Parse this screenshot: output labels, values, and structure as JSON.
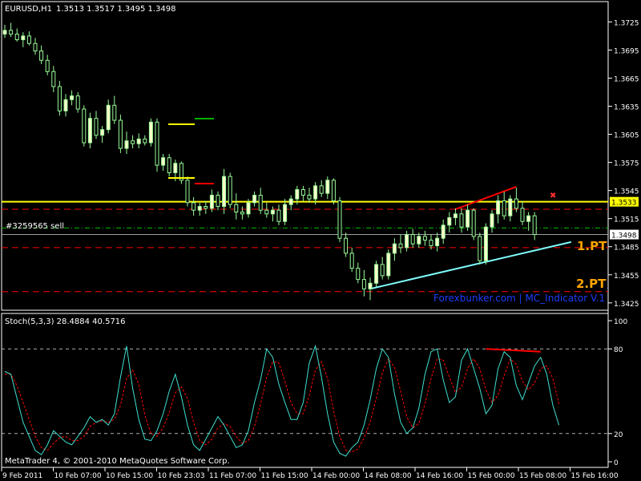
{
  "header": {
    "symbol": "EURUSD,H1",
    "ohlc": "1.3513 1.3517 1.3495 1.3498"
  },
  "order_label": "#3259565 sell",
  "annotations": {
    "pt1": "1.PT",
    "pt2": "2.PT",
    "watermark": "Forexbunker.com | MC_Indicator V.1",
    "cross": "✖"
  },
  "copyright": "MetaTrader 4, © 2001-2010 MetaQuotes Software Corp.",
  "stoch_label": "Stoch(5,3,3) 28.4884 40.5716",
  "colors": {
    "background": "#000000",
    "bull_candle": "#FFFFCC",
    "bear_candle": "#000000",
    "candle_outline": "#98FB98",
    "hline_yellow": "#FFFF00",
    "dashed_red": "#FF0000",
    "trend_cyan": "#7FFFFF",
    "trend_red": "#FF0000",
    "stoch_main": "#20B2AA",
    "stoch_signal": "#FF0000",
    "grid": "#C0C0C0",
    "watermark": "#0000FF",
    "pt_label": "#FFA500"
  },
  "chart_data": [
    {
      "type": "candlestick",
      "title": "EURUSD,H1",
      "ylim": [
        1.3418,
        1.3745
      ],
      "y_ticks": [
        1.3425,
        1.3455,
        1.3485,
        1.3515,
        1.3545,
        1.3575,
        1.3605,
        1.3635,
        1.3665,
        1.3695,
        1.3725
      ],
      "price_tags": [
        {
          "value": "1.3533",
          "style": "yellow"
        },
        {
          "value": "1.3498",
          "style": "white"
        }
      ],
      "x_tick_labels": [
        "9 Feb 2011",
        "10 Feb 07:00",
        "10 Feb 15:00",
        "10 Feb 23:03",
        "11 Feb 07:00",
        "11 Feb 15:00",
        "14 Feb 00:00",
        "14 Feb 08:00",
        "14 Feb 16:00",
        "15 Feb 00:00",
        "15 Feb 08:00",
        "15 Feb 16:00"
      ],
      "horizontal_lines": [
        {
          "value": 1.3533,
          "style": "solid",
          "color": "yellow"
        },
        {
          "value": 1.3525,
          "style": "dashed",
          "color": "red"
        },
        {
          "value": 1.3505,
          "style": "dashdot",
          "color": "green"
        },
        {
          "value": 1.3498,
          "style": "solid",
          "color": "gray"
        },
        {
          "value": 1.3484,
          "style": "dashed",
          "color": "red"
        },
        {
          "value": 1.3437,
          "style": "dashed",
          "color": "red"
        }
      ],
      "trend_lines": [
        {
          "color": "cyan",
          "from": {
            "bar": 60,
            "price": 1.344
          },
          "to": {
            "bar": 93,
            "price": 1.349
          }
        },
        {
          "color": "red",
          "from": {
            "bar": 74,
            "price": 1.3525
          },
          "to": {
            "bar": 84,
            "price": 1.3549
          }
        }
      ],
      "ohlc": [
        [
          1.3712,
          1.3722,
          1.3708,
          1.3716
        ],
        [
          1.3716,
          1.3724,
          1.3709,
          1.3712
        ],
        [
          1.3712,
          1.3718,
          1.3704,
          1.3706
        ],
        [
          1.3706,
          1.3714,
          1.3698,
          1.371
        ],
        [
          1.371,
          1.3715,
          1.37,
          1.3702
        ],
        [
          1.3702,
          1.3708,
          1.369,
          1.3694
        ],
        [
          1.3694,
          1.37,
          1.368,
          1.3684
        ],
        [
          1.3684,
          1.369,
          1.3668,
          1.3672
        ],
        [
          1.3672,
          1.3678,
          1.365,
          1.3656
        ],
        [
          1.3656,
          1.3662,
          1.3625,
          1.363
        ],
        [
          1.363,
          1.3648,
          1.3624,
          1.3642
        ],
        [
          1.3642,
          1.3652,
          1.3636,
          1.3646
        ],
        [
          1.3646,
          1.365,
          1.3628,
          1.3632
        ],
        [
          1.3632,
          1.3636,
          1.3592,
          1.3596
        ],
        [
          1.3596,
          1.3628,
          1.359,
          1.3622
        ],
        [
          1.3622,
          1.363,
          1.36,
          1.3604
        ],
        [
          1.3604,
          1.3614,
          1.3596,
          1.361
        ],
        [
          1.361,
          1.3642,
          1.3606,
          1.3636
        ],
        [
          1.3636,
          1.3646,
          1.3616,
          1.362
        ],
        [
          1.362,
          1.3626,
          1.3585,
          1.359
        ],
        [
          1.359,
          1.3608,
          1.3584,
          1.3598
        ],
        [
          1.3598,
          1.3604,
          1.359,
          1.3595
        ],
        [
          1.3595,
          1.3606,
          1.359,
          1.36
        ],
        [
          1.36,
          1.3604,
          1.3593,
          1.3596
        ],
        [
          1.3596,
          1.3622,
          1.3592,
          1.3618
        ],
        [
          1.3618,
          1.3622,
          1.3565,
          1.3572
        ],
        [
          1.3572,
          1.3584,
          1.3566,
          1.358
        ],
        [
          1.358,
          1.3584,
          1.356,
          1.3564
        ],
        [
          1.3564,
          1.3578,
          1.3555,
          1.3574
        ],
        [
          1.3574,
          1.3576,
          1.3552,
          1.3556
        ],
        [
          1.3556,
          1.356,
          1.3528,
          1.3532
        ],
        [
          1.3532,
          1.3538,
          1.3518,
          1.3524
        ],
        [
          1.3524,
          1.3532,
          1.3518,
          1.3528
        ],
        [
          1.3528,
          1.3534,
          1.352,
          1.3526
        ],
        [
          1.3526,
          1.3546,
          1.3522,
          1.354
        ],
        [
          1.354,
          1.3544,
          1.3524,
          1.3528
        ],
        [
          1.3528,
          1.3568,
          1.352,
          1.356
        ],
        [
          1.356,
          1.3564,
          1.3526,
          1.353
        ],
        [
          1.353,
          1.3542,
          1.3514,
          1.3522
        ],
        [
          1.3522,
          1.3528,
          1.3514,
          1.352
        ],
        [
          1.352,
          1.3536,
          1.3516,
          1.3532
        ],
        [
          1.3532,
          1.3544,
          1.3528,
          1.354
        ],
        [
          1.354,
          1.3548,
          1.352,
          1.3524
        ],
        [
          1.3524,
          1.3532,
          1.3516,
          1.352
        ],
        [
          1.352,
          1.3528,
          1.3512,
          1.3524
        ],
        [
          1.3524,
          1.353,
          1.3508,
          1.3512
        ],
        [
          1.3512,
          1.3536,
          1.3508,
          1.353
        ],
        [
          1.353,
          1.354,
          1.3524,
          1.3536
        ],
        [
          1.3536,
          1.355,
          1.353,
          1.3546
        ],
        [
          1.3546,
          1.355,
          1.3534,
          1.354
        ],
        [
          1.354,
          1.3548,
          1.3532,
          1.3536
        ],
        [
          1.3536,
          1.3554,
          1.353,
          1.355
        ],
        [
          1.355,
          1.3556,
          1.3538,
          1.3542
        ],
        [
          1.3542,
          1.356,
          1.3536,
          1.3556
        ],
        [
          1.3556,
          1.3558,
          1.353,
          1.3534
        ],
        [
          1.3534,
          1.3538,
          1.349,
          1.3494
        ],
        [
          1.3494,
          1.35,
          1.3474,
          1.3478
        ],
        [
          1.3478,
          1.3484,
          1.3458,
          1.3462
        ],
        [
          1.3462,
          1.3468,
          1.3446,
          1.345
        ],
        [
          1.345,
          1.346,
          1.3432,
          1.344
        ],
        [
          1.344,
          1.3452,
          1.3428,
          1.3446
        ],
        [
          1.3446,
          1.347,
          1.3442,
          1.3466
        ],
        [
          1.3466,
          1.3474,
          1.345,
          1.3454
        ],
        [
          1.3454,
          1.3482,
          1.345,
          1.3478
        ],
        [
          1.3478,
          1.3494,
          1.347,
          1.3488
        ],
        [
          1.3488,
          1.3498,
          1.3478,
          1.3484
        ],
        [
          1.3484,
          1.3502,
          1.348,
          1.3498
        ],
        [
          1.3498,
          1.3504,
          1.3484,
          1.3488
        ],
        [
          1.3488,
          1.35,
          1.3484,
          1.3496
        ],
        [
          1.3496,
          1.3502,
          1.3486,
          1.3492
        ],
        [
          1.3492,
          1.3498,
          1.3482,
          1.3486
        ],
        [
          1.3486,
          1.35,
          1.348,
          1.3494
        ],
        [
          1.3494,
          1.3514,
          1.3488,
          1.3508
        ],
        [
          1.3508,
          1.3522,
          1.35,
          1.3516
        ],
        [
          1.3516,
          1.3526,
          1.3508,
          1.352
        ],
        [
          1.352,
          1.3526,
          1.35,
          1.3506
        ],
        [
          1.3506,
          1.353,
          1.3502,
          1.3524
        ],
        [
          1.3524,
          1.3526,
          1.3492,
          1.3496
        ],
        [
          1.3496,
          1.35,
          1.3466,
          1.347
        ],
        [
          1.347,
          1.351,
          1.3466,
          1.3506
        ],
        [
          1.3506,
          1.3524,
          1.35,
          1.352
        ],
        [
          1.352,
          1.354,
          1.351,
          1.3534
        ],
        [
          1.3534,
          1.3544,
          1.3514,
          1.3518
        ],
        [
          1.3518,
          1.354,
          1.3512,
          1.3536
        ],
        [
          1.3536,
          1.3548,
          1.3522,
          1.3526
        ],
        [
          1.3526,
          1.3534,
          1.3508,
          1.3512
        ],
        [
          1.3512,
          1.3522,
          1.3502,
          1.3518
        ],
        [
          1.3518,
          1.3522,
          1.3492,
          1.3498
        ]
      ]
    },
    {
      "type": "line",
      "title": "Stoch(5,3,3) 28.4884 40.5716",
      "ylim": [
        0,
        100
      ],
      "y_ticks": [
        0,
        20,
        80,
        100
      ],
      "levels": [
        20,
        80
      ],
      "series": [
        {
          "values": [
            64,
            62,
            45,
            28,
            18,
            8,
            5,
            12,
            22,
            18,
            14,
            12,
            18,
            24,
            32,
            28,
            30,
            26,
            34,
            60,
            82,
            52,
            30,
            16,
            15,
            22,
            34,
            50,
            62,
            46,
            26,
            12,
            8,
            16,
            24,
            32,
            26,
            18,
            10,
            12,
            22,
            42,
            58,
            80,
            74,
            55,
            42,
            30,
            30,
            42,
            70,
            82,
            60,
            34,
            14,
            6,
            4,
            10,
            14,
            26,
            44,
            66,
            80,
            74,
            48,
            28,
            20,
            24,
            38,
            62,
            78,
            80,
            58,
            42,
            46,
            72,
            80,
            66,
            52,
            34,
            40,
            66,
            78,
            74,
            54,
            44,
            56,
            68,
            74,
            62,
            40,
            26
          ]
        },
        {
          "values": [
            62,
            62,
            54,
            42,
            30,
            18,
            10,
            8,
            13,
            17,
            18,
            15,
            15,
            18,
            25,
            28,
            29,
            28,
            30,
            40,
            59,
            65,
            55,
            33,
            20,
            18,
            24,
            35,
            49,
            53,
            45,
            28,
            15,
            12,
            16,
            24,
            27,
            25,
            18,
            13,
            15,
            25,
            41,
            60,
            71,
            70,
            57,
            42,
            34,
            34,
            47,
            65,
            71,
            59,
            36,
            18,
            8,
            7,
            9,
            17,
            28,
            45,
            63,
            73,
            67,
            50,
            32,
            24,
            27,
            41,
            59,
            73,
            72,
            60,
            49,
            53,
            66,
            73,
            66,
            51,
            42,
            47,
            61,
            73,
            69,
            57,
            51,
            56,
            66,
            68,
            59,
            41
          ]
        }
      ]
    }
  ]
}
